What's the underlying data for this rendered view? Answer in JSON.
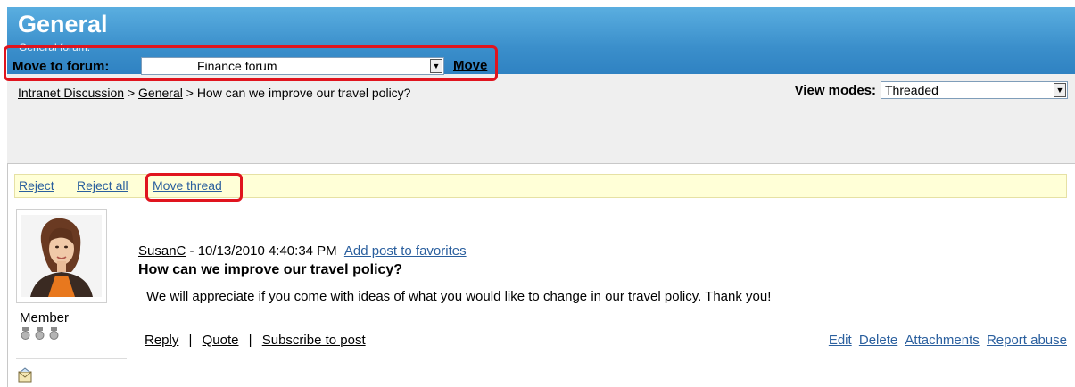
{
  "header": {
    "title": "General",
    "subtitle": "General forum."
  },
  "breadcrumb": {
    "root": "Intranet Discussion",
    "sep1": ">",
    "forum": "General",
    "sep2": ">",
    "thread": "How can we improve our travel policy?"
  },
  "view_modes": {
    "label": "View modes:",
    "selected": "Threaded"
  },
  "move_to_forum": {
    "label": "Move to forum:",
    "selected": "Finance forum",
    "button": "Move"
  },
  "actions": {
    "reject": "Reject",
    "reject_all": "Reject all",
    "move_thread": "Move thread"
  },
  "post": {
    "author": "SusanC",
    "meta_sep": " - ",
    "timestamp": "10/13/2010 4:40:34 PM",
    "favorites": "Add post to favorites",
    "title": "How can we improve our travel policy?",
    "body": "We will appreciate if you come with ideas of what you would like to change in our travel policy. Thank you!",
    "reply": "Reply",
    "quote": "Quote",
    "subscribe": "Subscribe to post",
    "separator": "|",
    "edit": "Edit",
    "delete": "Delete",
    "attachments": "Attachments",
    "report": "Report abuse"
  },
  "user": {
    "rank": "Member",
    "medal_count": 3
  },
  "colors": {
    "header": "#3b8fcb",
    "highlight": "#e0141e",
    "link": "#2a5f9e",
    "actionbar": "#ffffd7"
  }
}
